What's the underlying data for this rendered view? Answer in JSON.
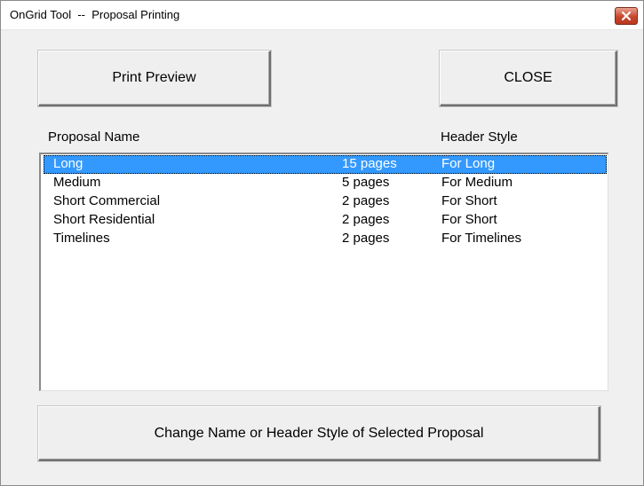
{
  "window": {
    "title": "OnGrid Tool  --  Proposal Printing",
    "close_icon": "close-icon",
    "close_color": "#c7472d"
  },
  "buttons": {
    "print_preview": "Print Preview",
    "close": "CLOSE",
    "change": "Change Name or Header Style of Selected Proposal"
  },
  "list": {
    "header_name": "Proposal Name",
    "header_style": "Header Style",
    "selected_color": "#3399ff",
    "rows": [
      {
        "name": "Long",
        "pages": "15 pages",
        "style": "For Long",
        "selected": true
      },
      {
        "name": "Medium",
        "pages": "5 pages",
        "style": "For Medium"
      },
      {
        "name": "Short Commercial",
        "pages": "2 pages",
        "style": "For Short"
      },
      {
        "name": "Short Residential",
        "pages": "2 pages",
        "style": "For Short"
      },
      {
        "name": "Timelines",
        "pages": "2 pages",
        "style": "For Timelines"
      }
    ]
  }
}
